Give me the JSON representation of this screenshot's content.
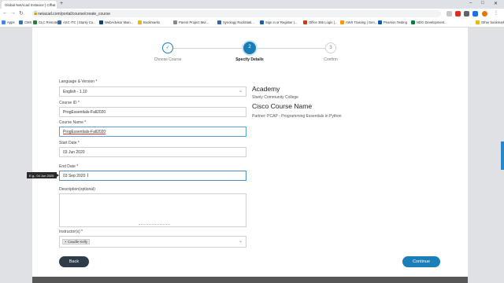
{
  "browser": {
    "tab_title": "Global NetAcad Instance | Creat",
    "tab_close": "×",
    "new_tab": "+",
    "win_min": "–",
    "win_max": "□",
    "win_close": "✕",
    "url": "netacad.com/portal/course/create_course",
    "bookmarks": [
      {
        "label": "Apps",
        "color": "#4285f4"
      },
      {
        "label": "CMS",
        "color": "#3a6fb0"
      },
      {
        "label": "CLC Remote",
        "color": "#2a7d3f"
      },
      {
        "label": "ASC ITC | Stanly Co...",
        "color": "#2c6bb3"
      },
      {
        "label": "WebAdvisor Main...",
        "color": "#123f73"
      },
      {
        "label": "Bookmarks",
        "color": "#f4b400"
      },
      {
        "label": "Parent Project Mul...",
        "color": "#888888"
      },
      {
        "label": "Synology RackStati...",
        "color": "#3366aa"
      },
      {
        "label": "Sign in or Register |...",
        "color": "#1b5ea5"
      },
      {
        "label": "Office 365 Login |...",
        "color": "#d83b01"
      },
      {
        "label": "AWS Training | Gen...",
        "color": "#ff9900"
      },
      {
        "label": "Pearson Testing",
        "color": "#0b5aa6"
      },
      {
        "label": "NDG Development...",
        "color": "#0f7a3e"
      },
      {
        "label": "Other bookmarks",
        "color": "#f4b400"
      }
    ]
  },
  "stepper": {
    "steps": [
      {
        "label": "Choose Course",
        "number": "✓"
      },
      {
        "label": "Specify Details",
        "number": "2"
      },
      {
        "label": "Confirm",
        "number": "3"
      }
    ]
  },
  "form": {
    "language_label": "Language & Version *",
    "language_value": "English - 1.10",
    "course_id_label": "Course ID *",
    "course_id_value": "ProgEssentials-Fall2020",
    "course_name_label": "Course Name *",
    "course_name_value": "ProgEssentials-Fall2020",
    "start_date_label": "Start Date *",
    "start_date_value": "03 Jun 2020",
    "end_date_label": "End Date *",
    "end_date_value": "03 Sep 2020",
    "end_date_tooltip": "E.g., 04 Jun 2020",
    "description_label": "Description(optional)",
    "instructors_label": "Instructor(s) *",
    "instructor_chip": "× Caudle Kelly",
    "back_button": "Back",
    "continue_button": "Continue"
  },
  "summary": {
    "academy_heading": "Academy",
    "academy_name": "Stanly Community College",
    "course_heading": "Cisco Course Name",
    "course_name": "Partner: PCAP - Programming Essentials in Python"
  },
  "colors": {
    "accent": "#1a7fb8",
    "back_button": "#2f3b48",
    "active_border": "#4a90c8"
  }
}
